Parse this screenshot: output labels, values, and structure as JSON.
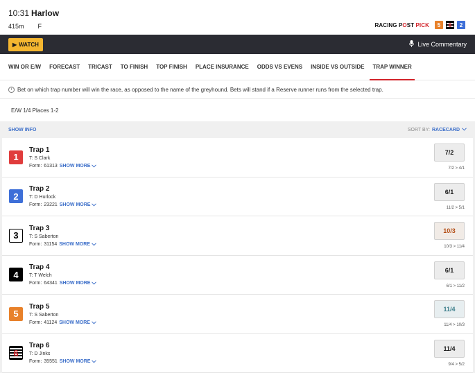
{
  "header": {
    "time": "10:31",
    "venue": "Harlow",
    "distance": "415m",
    "grade": "F",
    "pick_label_a": "RACING P",
    "pick_label_b": "ST",
    "pick_label_c": "PICK",
    "pick_traps": [
      {
        "number": "5",
        "color": "#e8812a"
      },
      {
        "number": "6",
        "color": "#000000"
      },
      {
        "number": "2",
        "color": "#3e6fd8"
      }
    ]
  },
  "bar": {
    "watch_label": "WATCH",
    "live_label": "Live Commentary"
  },
  "tabs": [
    {
      "label": "WIN OR E/W"
    },
    {
      "label": "FORECAST"
    },
    {
      "label": "TRICAST"
    },
    {
      "label": "TO FINISH"
    },
    {
      "label": "TOP FINISH"
    },
    {
      "label": "PLACE INSURANCE"
    },
    {
      "label": "ODDS VS EVENS"
    },
    {
      "label": "INSIDE VS OUTSIDE"
    },
    {
      "label": "TRAP WINNER"
    }
  ],
  "info_text": "Bet on which trap number will win the race, as opposed to the name of the greyhound. Bets will stand if a Reserve runner runs from the selected trap.",
  "ew_terms": "E/W 1/4 Places 1-2",
  "show_info": "SHOW INFO",
  "sort": {
    "label": "SORT BY:",
    "value": "RACECARD"
  },
  "runners": [
    {
      "trap": "1",
      "name": "Trap 1",
      "trainer": "T: S Clark",
      "form_label": "Form:",
      "form": "61313",
      "show_more": "SHOW MORE",
      "odds": "7/2",
      "movement": "7/2 > 4/1",
      "color": "#e03c3c"
    },
    {
      "trap": "2",
      "name": "Trap 2",
      "trainer": "T: D Hurlock",
      "form_label": "Form:",
      "form": "23221",
      "show_more": "SHOW MORE",
      "odds": "6/1",
      "movement": "11/2 > 5/1",
      "color": "#3e6fd8"
    },
    {
      "trap": "3",
      "name": "Trap 3",
      "trainer": "T: S Saberton",
      "form_label": "Form:",
      "form": "31154",
      "show_more": "SHOW MORE",
      "odds": "10/3",
      "movement": "10/3 > 11/4",
      "color": "#ffffff"
    },
    {
      "trap": "4",
      "name": "Trap 4",
      "trainer": "T: T Welch",
      "form_label": "Form:",
      "form": "64341",
      "show_more": "SHOW MORE",
      "odds": "6/1",
      "movement": "6/1 > 11/2",
      "color": "#000000"
    },
    {
      "trap": "5",
      "name": "Trap 5",
      "trainer": "T: S Saberton",
      "form_label": "Form:",
      "form": "41124",
      "show_more": "SHOW MORE",
      "odds": "11/4",
      "movement": "11/4 > 10/3",
      "color": "#e8812a"
    },
    {
      "trap": "6",
      "name": "Trap 6",
      "trainer": "T: D Jinks",
      "form_label": "Form:",
      "form": "35551",
      "show_more": "SHOW MORE",
      "odds": "11/4",
      "movement": "9/4 > 5/2",
      "color": "#000000"
    }
  ]
}
